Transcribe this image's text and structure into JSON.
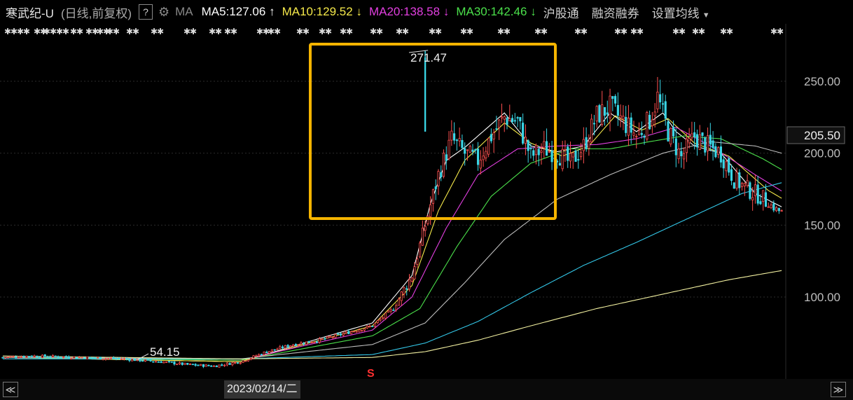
{
  "header": {
    "stock_name": "寒武纪-U",
    "mode": "(日线,前复权)",
    "help": "?",
    "ma_label": "MA",
    "ma5": "MA5:127.06",
    "ma10": "MA10:129.52",
    "ma20": "MA20:138.58",
    "ma30": "MA30:142.46",
    "nav_hgt": "沪股通",
    "nav_margin": "融资融券",
    "nav_ma_settings": "设置均线",
    "arrow_up": "↑",
    "arrow_down": "↓"
  },
  "colors": {
    "up": "#ff5050",
    "down": "#3ad6e6",
    "ma5": "#ffffff",
    "ma10": "#f5e94a",
    "ma20": "#e23fe0",
    "ma30": "#4be04b",
    "ma60": "#bdbdbd",
    "ma120": "#33c7e8",
    "ma250": "#f2f0a0",
    "highlight": "#f5b400"
  },
  "markers": {
    "glyph": "✱✱"
  },
  "bottom": {
    "date": "2023/02/14/二",
    "left_arrow": "≪",
    "right_arrow": "≫"
  },
  "chart_data": {
    "type": "candlestick",
    "y_ticks": [
      "250.00",
      "200.00",
      "150.00",
      "100.00"
    ],
    "y_tick_values": [
      250,
      200,
      150,
      100
    ],
    "current_price_label": "205.50",
    "current_price": 205.5,
    "high_annotation": "271.47",
    "high_value": 271.47,
    "low_annotation": "54.15",
    "low_value": 54.15,
    "signal_marker": "S",
    "ylim": [
      45,
      300
    ],
    "num_bars": 296,
    "key_closes": [
      [
        0,
        58
      ],
      [
        10,
        59
      ],
      [
        30,
        58
      ],
      [
        45,
        57
      ],
      [
        60,
        55
      ],
      [
        70,
        53
      ],
      [
        80,
        52
      ],
      [
        90,
        55
      ],
      [
        100,
        62
      ],
      [
        110,
        67
      ],
      [
        120,
        70
      ],
      [
        130,
        75
      ],
      [
        140,
        80
      ],
      [
        148,
        92
      ],
      [
        155,
        115
      ],
      [
        160,
        150
      ],
      [
        165,
        185
      ],
      [
        170,
        210
      ],
      [
        175,
        200
      ],
      [
        180,
        195
      ],
      [
        185,
        212
      ],
      [
        190,
        225
      ],
      [
        195,
        222
      ],
      [
        200,
        198
      ],
      [
        205,
        203
      ],
      [
        210,
        200
      ],
      [
        215,
        193
      ],
      [
        220,
        205
      ],
      [
        225,
        226
      ],
      [
        230,
        232
      ],
      [
        235,
        222
      ],
      [
        240,
        212
      ],
      [
        245,
        223
      ],
      [
        248,
        239
      ],
      [
        252,
        215
      ],
      [
        257,
        197
      ],
      [
        262,
        212
      ],
      [
        267,
        205
      ],
      [
        272,
        200
      ],
      [
        277,
        182
      ],
      [
        282,
        175
      ],
      [
        287,
        170
      ],
      [
        292,
        162
      ],
      [
        297,
        157
      ],
      [
        302,
        160
      ],
      [
        307,
        158
      ],
      [
        312,
        150
      ],
      [
        317,
        145
      ],
      [
        322,
        148
      ],
      [
        325,
        150
      ],
      [
        330,
        145
      ],
      [
        335,
        139
      ],
      [
        340,
        135
      ],
      [
        345,
        128
      ],
      [
        349,
        127
      ]
    ],
    "ma_lines": [
      {
        "name": "MA5",
        "color_key": "ma5",
        "points": [
          [
            0,
            58
          ],
          [
            90,
            55
          ],
          [
            140,
            82
          ],
          [
            155,
            115
          ],
          [
            162,
            165
          ],
          [
            168,
            195
          ],
          [
            175,
            204
          ],
          [
            190,
            228
          ],
          [
            200,
            205
          ],
          [
            210,
            201
          ],
          [
            220,
            205
          ],
          [
            230,
            228
          ],
          [
            240,
            215
          ],
          [
            250,
            228
          ],
          [
            255,
            215
          ],
          [
            262,
            205
          ],
          [
            272,
            200
          ],
          [
            285,
            172
          ],
          [
            300,
            158
          ],
          [
            312,
            150
          ],
          [
            325,
            150
          ],
          [
            337,
            138
          ],
          [
            349,
            128
          ]
        ]
      },
      {
        "name": "MA10",
        "color_key": "ma10",
        "points": [
          [
            0,
            58
          ],
          [
            90,
            55
          ],
          [
            140,
            80
          ],
          [
            155,
            108
          ],
          [
            165,
            160
          ],
          [
            175,
            195
          ],
          [
            190,
            221
          ],
          [
            200,
            207
          ],
          [
            212,
            198
          ],
          [
            222,
            205
          ],
          [
            232,
            226
          ],
          [
            242,
            216
          ],
          [
            252,
            224
          ],
          [
            262,
            207
          ],
          [
            275,
            198
          ],
          [
            290,
            174
          ],
          [
            305,
            158
          ],
          [
            318,
            149
          ],
          [
            330,
            144
          ],
          [
            349,
            129
          ]
        ]
      },
      {
        "name": "MA20",
        "color_key": "ma20",
        "points": [
          [
            0,
            58
          ],
          [
            90,
            56
          ],
          [
            140,
            77
          ],
          [
            155,
            100
          ],
          [
            168,
            148
          ],
          [
            180,
            185
          ],
          [
            195,
            203
          ],
          [
            210,
            205
          ],
          [
            225,
            206
          ],
          [
            240,
            210
          ],
          [
            255,
            218
          ],
          [
            268,
            205
          ],
          [
            285,
            185
          ],
          [
            300,
            168
          ],
          [
            315,
            155
          ],
          [
            330,
            147
          ],
          [
            349,
            139
          ]
        ]
      },
      {
        "name": "MA30",
        "color_key": "ma30",
        "points": [
          [
            0,
            58
          ],
          [
            90,
            56
          ],
          [
            140,
            73
          ],
          [
            158,
            92
          ],
          [
            172,
            135
          ],
          [
            185,
            170
          ],
          [
            200,
            193
          ],
          [
            215,
            203
          ],
          [
            230,
            203
          ],
          [
            245,
            208
          ],
          [
            258,
            212
          ],
          [
            272,
            210
          ],
          [
            288,
            196
          ],
          [
            305,
            178
          ],
          [
            320,
            160
          ],
          [
            335,
            150
          ],
          [
            349,
            142
          ]
        ]
      },
      {
        "name": "MA60",
        "color_key": "ma60",
        "points": [
          [
            0,
            58
          ],
          [
            90,
            57
          ],
          [
            140,
            67
          ],
          [
            160,
            82
          ],
          [
            175,
            110
          ],
          [
            190,
            140
          ],
          [
            210,
            168
          ],
          [
            230,
            185
          ],
          [
            250,
            200
          ],
          [
            268,
            208
          ],
          [
            285,
            205
          ],
          [
            305,
            195
          ],
          [
            325,
            182
          ],
          [
            340,
            170
          ],
          [
            349,
            161
          ]
        ]
      },
      {
        "name": "MA120",
        "color_key": "ma120",
        "points": [
          [
            0,
            57
          ],
          [
            90,
            57
          ],
          [
            140,
            60
          ],
          [
            160,
            68
          ],
          [
            180,
            83
          ],
          [
            200,
            103
          ],
          [
            220,
            122
          ],
          [
            240,
            138
          ],
          [
            260,
            155
          ],
          [
            280,
            172
          ],
          [
            300,
            182
          ],
          [
            320,
            190
          ],
          [
            335,
            193
          ],
          [
            349,
            188
          ]
        ]
      },
      {
        "name": "MA250",
        "color_key": "ma250",
        "points": [
          [
            0,
            59
          ],
          [
            90,
            57
          ],
          [
            140,
            58
          ],
          [
            160,
            62
          ],
          [
            180,
            70
          ],
          [
            200,
            80
          ],
          [
            225,
            92
          ],
          [
            250,
            102
          ],
          [
            275,
            112
          ],
          [
            300,
            120
          ],
          [
            325,
            127
          ],
          [
            349,
            130
          ]
        ]
      }
    ]
  }
}
